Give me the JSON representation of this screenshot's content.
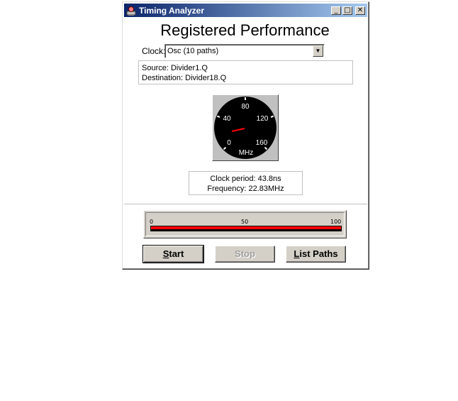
{
  "window": {
    "title": "Timing Analyzer"
  },
  "titlebar": {
    "minimize": "_",
    "maximize": "□",
    "close": "✕"
  },
  "heading": "Registered Performance",
  "clock": {
    "label": "Clock:",
    "selected": "Osc (10 paths)"
  },
  "path": {
    "source": "Source: Divider1.Q",
    "destination": "Destination: Divider18.Q"
  },
  "gauge": {
    "unit": "MHz",
    "labels": [
      "0",
      "40",
      "80",
      "120",
      "160"
    ],
    "needle_value": 22.83,
    "needle_color": "#ff0000"
  },
  "info": {
    "clock_period": "Clock period: 43.8ns",
    "frequency": "Frequency: 22.83MHz"
  },
  "progress": {
    "labels": [
      "0",
      "50",
      "100"
    ],
    "value_percent": 100,
    "fill_color": "#ff0000"
  },
  "buttons": {
    "start": "Start",
    "stop": "Stop",
    "list_paths": "List Paths"
  }
}
